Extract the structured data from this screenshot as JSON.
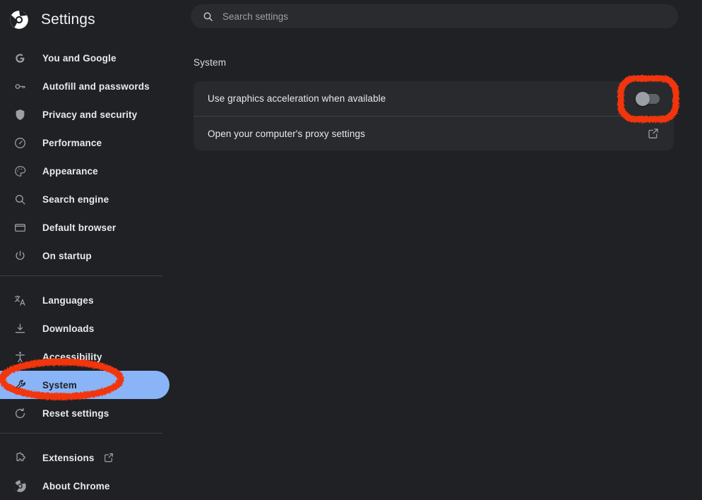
{
  "app": {
    "title": "Settings",
    "logo_icon": "chrome-logo-icon"
  },
  "search": {
    "placeholder": "Search settings",
    "value": "",
    "icon": "search-icon"
  },
  "sidebar": {
    "groups": [
      {
        "items": [
          {
            "label": "You and Google",
            "icon": "google-g-icon",
            "selected": false,
            "trailing_icon": ""
          },
          {
            "label": "Autofill and passwords",
            "icon": "key-icon",
            "selected": false,
            "trailing_icon": ""
          },
          {
            "label": "Privacy and security",
            "icon": "shield-icon",
            "selected": false,
            "trailing_icon": ""
          },
          {
            "label": "Performance",
            "icon": "speedometer-icon",
            "selected": false,
            "trailing_icon": ""
          },
          {
            "label": "Appearance",
            "icon": "palette-icon",
            "selected": false,
            "trailing_icon": ""
          },
          {
            "label": "Search engine",
            "icon": "search-icon",
            "selected": false,
            "trailing_icon": ""
          },
          {
            "label": "Default browser",
            "icon": "browser-window-icon",
            "selected": false,
            "trailing_icon": ""
          },
          {
            "label": "On startup",
            "icon": "power-icon",
            "selected": false,
            "trailing_icon": ""
          }
        ]
      },
      {
        "items": [
          {
            "label": "Languages",
            "icon": "translate-icon",
            "selected": false,
            "trailing_icon": ""
          },
          {
            "label": "Downloads",
            "icon": "download-icon",
            "selected": false,
            "trailing_icon": ""
          },
          {
            "label": "Accessibility",
            "icon": "accessibility-icon",
            "selected": false,
            "trailing_icon": ""
          },
          {
            "label": "System",
            "icon": "wrench-icon",
            "selected": true,
            "trailing_icon": ""
          },
          {
            "label": "Reset settings",
            "icon": "restore-icon",
            "selected": false,
            "trailing_icon": ""
          }
        ]
      },
      {
        "items": [
          {
            "label": "Extensions",
            "icon": "puzzle-piece-icon",
            "selected": false,
            "trailing_icon": "external-link-icon"
          },
          {
            "label": "About Chrome",
            "icon": "chrome-logo-icon",
            "selected": false,
            "trailing_icon": ""
          }
        ]
      }
    ]
  },
  "main": {
    "section_title": "System",
    "rows": [
      {
        "label": "Use graphics acceleration when available",
        "control": "toggle",
        "toggle_state": "off"
      },
      {
        "label": "Open your computer's proxy settings",
        "control": "external-link",
        "trailing_icon": "external-link-icon"
      }
    ]
  },
  "annotations": {
    "color": "#f2350d",
    "marks": [
      {
        "name": "highlight-graphics-toggle",
        "shape": "rounded-rect"
      },
      {
        "name": "highlight-system-nav-item",
        "shape": "ellipse"
      }
    ]
  },
  "colors": {
    "background": "#202124",
    "card": "#292a2d",
    "selected_pill": "#8ab4f8",
    "text": "#e8eaed",
    "muted_text": "#9aa0a6",
    "divider": "#3c4043",
    "annotation_red": "#f2350d"
  }
}
